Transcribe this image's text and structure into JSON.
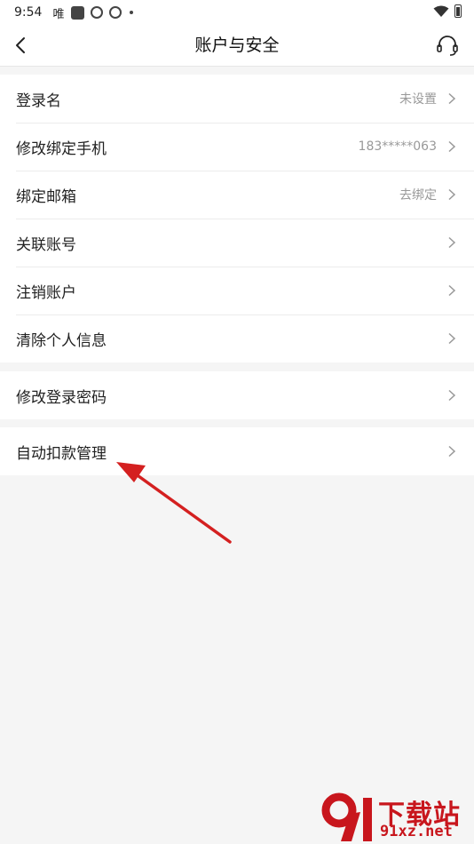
{
  "status_bar": {
    "time": "9:54",
    "carrier": "唯"
  },
  "header": {
    "title": "账户与安全"
  },
  "groups": [
    {
      "items": [
        {
          "label": "登录名",
          "value": "未设置"
        },
        {
          "label": "修改绑定手机",
          "value": "183*****063"
        },
        {
          "label": "绑定邮箱",
          "value": "去绑定"
        },
        {
          "label": "关联账号",
          "value": ""
        },
        {
          "label": "注销账户",
          "value": ""
        },
        {
          "label": "清除个人信息",
          "value": ""
        }
      ]
    },
    {
      "items": [
        {
          "label": "修改登录密码",
          "value": ""
        }
      ]
    },
    {
      "items": [
        {
          "label": "自动扣款管理",
          "value": ""
        }
      ]
    }
  ],
  "watermark": {
    "line1": "下载站",
    "line2": "91xz.net",
    "logo_text": "91"
  },
  "colors": {
    "annotation_arrow": "#d42020",
    "watermark": "#c8161d",
    "background": "#f5f5f5"
  }
}
